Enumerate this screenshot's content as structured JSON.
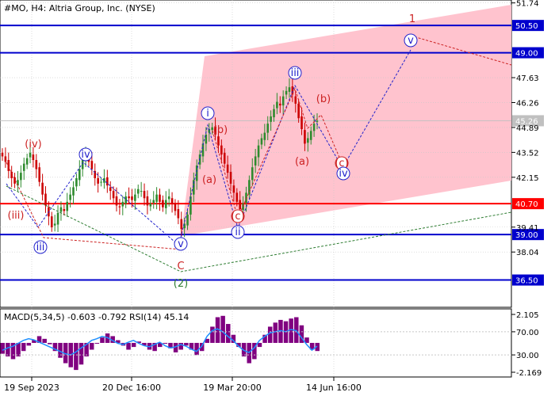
{
  "colors": {
    "channel": "#ffc0cb",
    "blue_line": "#0000cd",
    "red_line": "#ff0000",
    "grid": "#c8c8c8",
    "wave_red": "#cc2222",
    "wave_blue": "#2222cc",
    "wave_green": "#2e7d32",
    "bull_candle": "#2e8b2e",
    "bear_candle": "#cc0000",
    "macd_hist": "#800080",
    "rsi_line": "#1e90ff",
    "current_price_label": "#c0c0c0"
  },
  "chart_data": [
    {
      "type": "candlestick",
      "title": "#MO, H4:  Altria Group, Inc. (NYSE)",
      "ylim": [
        35.0,
        51.9
      ],
      "y_ticks": [
        "51.74",
        "50.50",
        "49.00",
        "47.63",
        "46.26",
        "45.26",
        "44.89",
        "43.52",
        "42.15",
        "40.70",
        "39.41",
        "39.00",
        "38.04",
        "36.50"
      ],
      "x_ticks": [
        "19 Sep 2023",
        "20 Dec 16:00",
        "19 Mar 20:00",
        "14 Jun 16:00"
      ],
      "current_price": 45.26,
      "close_series": [
        43.3,
        43.0,
        42.5,
        42.1,
        41.8,
        42.0,
        42.4,
        42.9,
        43.2,
        43.5,
        43.1,
        42.6,
        41.9,
        41.2,
        40.6,
        40.0,
        39.4,
        39.6,
        40.2,
        40.5,
        40.3,
        40.8,
        41.2,
        41.6,
        42.1,
        42.6,
        43.1,
        43.5,
        43.0,
        42.6,
        42.1,
        41.8,
        41.9,
        42.1,
        41.7,
        41.4,
        41.0,
        40.6,
        40.5,
        40.8,
        41.1,
        41.0,
        40.9,
        41.2,
        41.5,
        41.4,
        41.0,
        40.6,
        40.7,
        40.9,
        41.2,
        40.8,
        40.5,
        40.9,
        41.1,
        40.7,
        40.3,
        39.9,
        39.3,
        39.6,
        40.1,
        41.1,
        42.0,
        42.8,
        43.4,
        44.0,
        44.5,
        44.8,
        44.9,
        44.5,
        43.9,
        43.4,
        42.9,
        42.4,
        41.8,
        41.3,
        40.8,
        40.4,
        40.7,
        41.3,
        42.0,
        42.7,
        43.3,
        43.9,
        44.3,
        44.6,
        45.1,
        45.5,
        45.9,
        46.3,
        46.1,
        46.6,
        46.9,
        47.1,
        46.7,
        46.2,
        45.4,
        44.8,
        44.0,
        44.3,
        44.7,
        45.1,
        45.26
      ],
      "horizontal_levels": [
        {
          "value": 50.5,
          "label": "50.50",
          "color": "blue"
        },
        {
          "value": 49.0,
          "label": "49.00",
          "color": "blue"
        },
        {
          "value": 40.7,
          "label": "40.70",
          "color": "red"
        },
        {
          "value": 39.0,
          "label": "39.00",
          "color": "blue"
        },
        {
          "value": 36.5,
          "label": "36.50",
          "color": "blue"
        }
      ],
      "wave_labels": [
        {
          "text": "(iv)",
          "color": "red",
          "circled": false
        },
        {
          "text": "(iii)",
          "color": "red",
          "circled": false
        },
        {
          "text": "iv",
          "color": "blue",
          "circled": true
        },
        {
          "text": "iii",
          "color": "blue",
          "circled": true
        },
        {
          "text": "v",
          "color": "blue",
          "circled": true
        },
        {
          "text": "C",
          "color": "red",
          "circled": false
        },
        {
          "text": "(2)",
          "color": "green",
          "circled": false
        },
        {
          "text": "i",
          "color": "blue",
          "circled": true
        },
        {
          "text": "(b)",
          "color": "red",
          "circled": false
        },
        {
          "text": "(a)",
          "color": "red",
          "circled": false
        },
        {
          "text": "(c)",
          "color": "red",
          "circled": true
        },
        {
          "text": "ii",
          "color": "blue",
          "circled": true
        },
        {
          "text": "iii",
          "color": "blue",
          "circled": true
        },
        {
          "text": "(b)",
          "color": "red",
          "circled": false
        },
        {
          "text": "(a)",
          "color": "red",
          "circled": false
        },
        {
          "text": "(c)",
          "color": "red",
          "circled": true
        },
        {
          "text": "iv",
          "color": "blue",
          "circled": true
        },
        {
          "text": "v",
          "color": "blue",
          "circled": true
        },
        {
          "text": "1",
          "color": "red",
          "circled": false
        }
      ]
    },
    {
      "type": "indicator",
      "title": "MACD(5,34,5) -0.603 -0.792 RSI(14) 45.14",
      "y_ticks": [
        "2.105",
        "70.00",
        "30.00",
        "-2.169"
      ],
      "x_ticks": [
        "19 Sep 2023",
        "20 Dec 16:00",
        "19 Mar 20:00",
        "14 Jun 16:00"
      ],
      "macd_values": [
        -0.8,
        -1.0,
        -1.2,
        -1.0,
        -0.6,
        -0.2,
        0.2,
        0.5,
        0.3,
        -0.1,
        -0.6,
        -1.1,
        -1.5,
        -1.8,
        -2.0,
        -1.6,
        -1.0,
        -0.5,
        0.0,
        0.4,
        0.7,
        0.5,
        0.2,
        -0.2,
        -0.5,
        -0.3,
        0.1,
        -0.2,
        -0.5,
        -0.6,
        -0.3,
        0.0,
        -0.4,
        -0.7,
        -0.5,
        -0.2,
        -0.5,
        -0.9,
        -0.6,
        0.3,
        1.2,
        1.9,
        2.0,
        1.4,
        0.6,
        -0.3,
        -1.0,
        -1.5,
        -1.2,
        -0.3,
        0.6,
        1.2,
        1.5,
        1.7,
        1.6,
        1.8,
        1.9,
        1.3,
        0.4,
        -0.5,
        -0.6
      ],
      "rsi_values": [
        38,
        42,
        45,
        50,
        55,
        58,
        56,
        52,
        48,
        44,
        40,
        36,
        32,
        30,
        35,
        42,
        48,
        55,
        58,
        62,
        60,
        55,
        50,
        48,
        52,
        55,
        50,
        46,
        44,
        48,
        52,
        46,
        42,
        44,
        48,
        45,
        40,
        36,
        45,
        62,
        72,
        75,
        70,
        62,
        55,
        45,
        38,
        34,
        42,
        55,
        62,
        68,
        70,
        72,
        70,
        74,
        72,
        60,
        48,
        38,
        45.14
      ]
    }
  ]
}
